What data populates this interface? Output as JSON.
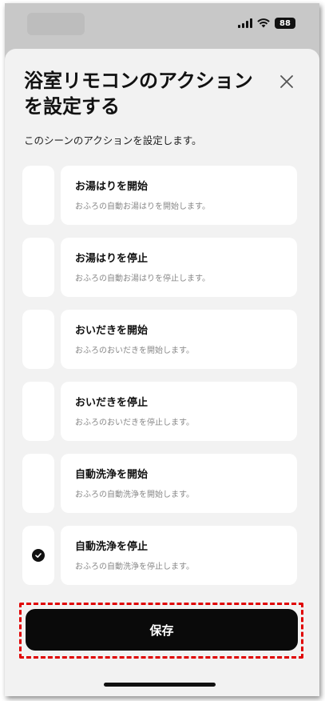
{
  "status_bar": {
    "battery_level": "88"
  },
  "sheet": {
    "title": "浴室リモコンのアクションを設定する",
    "description": "このシーンのアクションを設定します。",
    "actions": [
      {
        "label": "お湯はりを開始",
        "description": "おふろの自動お湯はりを開始します。",
        "selected": false
      },
      {
        "label": "お湯はりを停止",
        "description": "おふろの自動お湯はりを停止します。",
        "selected": false
      },
      {
        "label": "おいだきを開始",
        "description": "おふろのおいだきを開始します。",
        "selected": false
      },
      {
        "label": "おいだきを停止",
        "description": "おふろのおいだきを停止します。",
        "selected": false
      },
      {
        "label": "自動洗浄を開始",
        "description": "おふろの自動洗浄を開始します。",
        "selected": false
      },
      {
        "label": "自動洗浄を停止",
        "description": "おふろの自動洗浄を停止します。",
        "selected": true
      }
    ],
    "save_label": "保存"
  },
  "colors": {
    "save_button": "#0a0a0a",
    "highlight": "#e00000",
    "sheet_background": "#f2f2f2"
  }
}
